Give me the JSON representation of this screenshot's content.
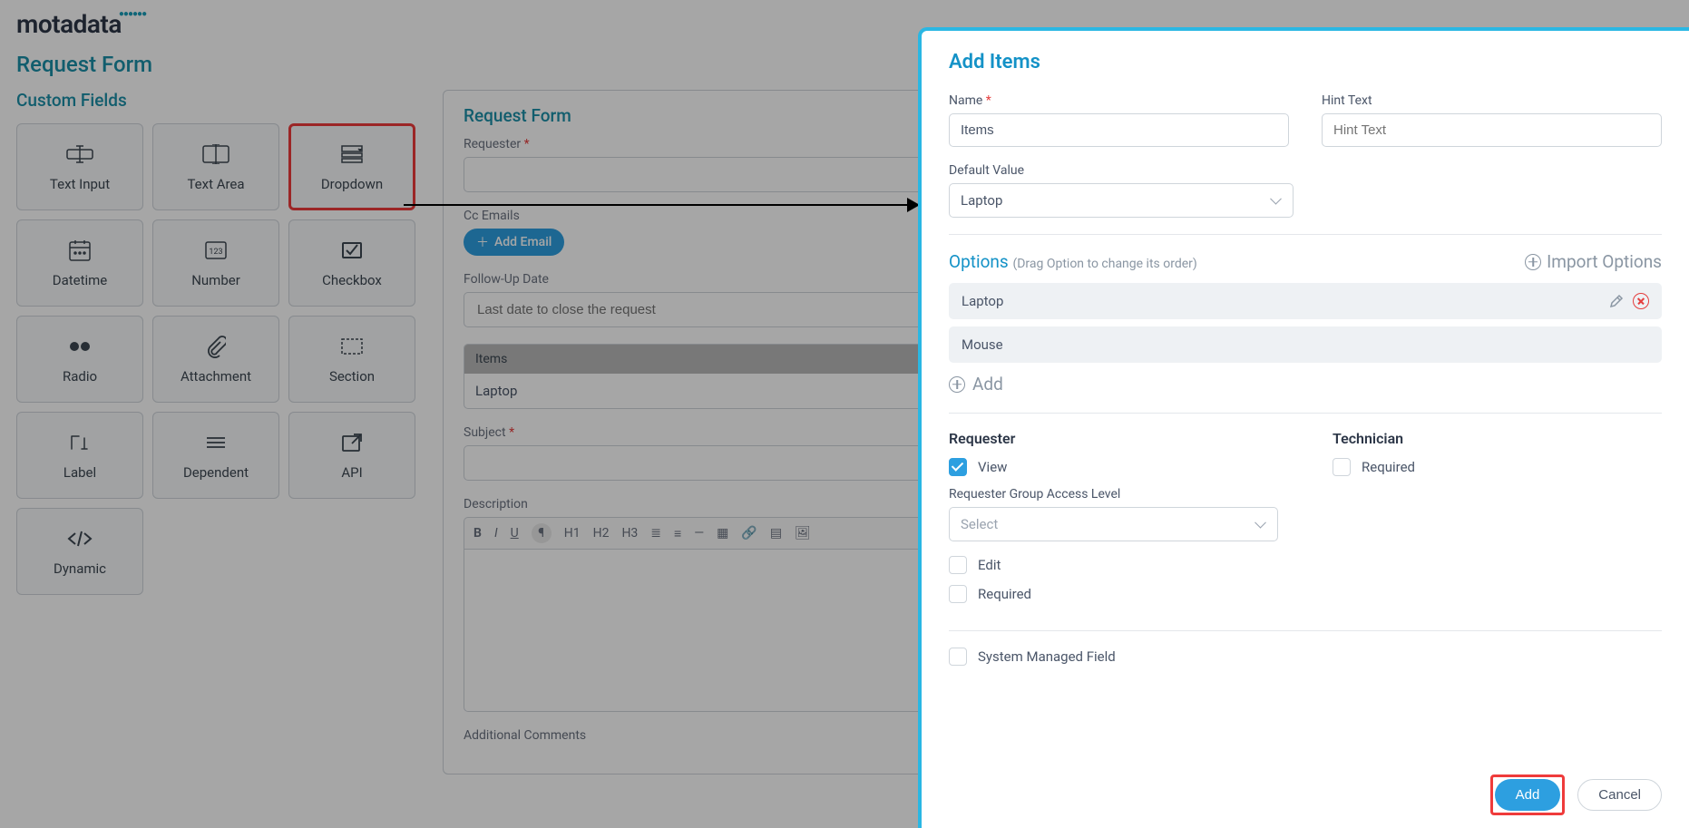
{
  "logo": "motadata",
  "page_title": "Request Form",
  "sidebar": {
    "title": "Custom Fields",
    "fields": [
      {
        "label": "Text Input"
      },
      {
        "label": "Text Area"
      },
      {
        "label": "Dropdown",
        "highlight": true
      },
      {
        "label": "Datetime"
      },
      {
        "label": "Number"
      },
      {
        "label": "Checkbox"
      },
      {
        "label": "Radio"
      },
      {
        "label": "Attachment"
      },
      {
        "label": "Section"
      },
      {
        "label": "Label"
      },
      {
        "label": "Dependent"
      },
      {
        "label": "API"
      },
      {
        "label": "Dynamic"
      }
    ]
  },
  "form": {
    "title": "Request Form",
    "requester_label": "Requester",
    "cc_label": "Cc Emails",
    "add_email": "Add Email",
    "followup_label": "Follow-Up Date",
    "followup_placeholder": "Last date to close the request",
    "items_header": "Items",
    "items_value": "Laptop",
    "subject_label": "Subject",
    "description_label": "Description",
    "toolbar": [
      "B",
      "I",
      "U",
      "¶",
      "H1",
      "H2",
      "H3",
      "≣",
      "≡",
      "—",
      "▦",
      "🔗",
      "▤",
      "🖼"
    ],
    "additional_comments_label": "Additional Comments"
  },
  "panel": {
    "title": "Add Items",
    "name_label": "Name",
    "name_value": "Items",
    "hint_label": "Hint Text",
    "hint_placeholder": "Hint Text",
    "default_label": "Default Value",
    "default_value": "Laptop",
    "options_title": "Options",
    "options_hint": "(Drag Option to change its order)",
    "import_label": "Import Options",
    "options": [
      "Laptop",
      "Mouse"
    ],
    "add_option": "Add",
    "requester_heading": "Requester",
    "technician_heading": "Technician",
    "view_label": "View",
    "edit_label": "Edit",
    "required_label": "Required",
    "tech_required_label": "Required",
    "group_access_label": "Requester Group Access Level",
    "group_access_placeholder": "Select",
    "system_managed_label": "System Managed Field",
    "add_btn": "Add",
    "cancel_btn": "Cancel"
  }
}
